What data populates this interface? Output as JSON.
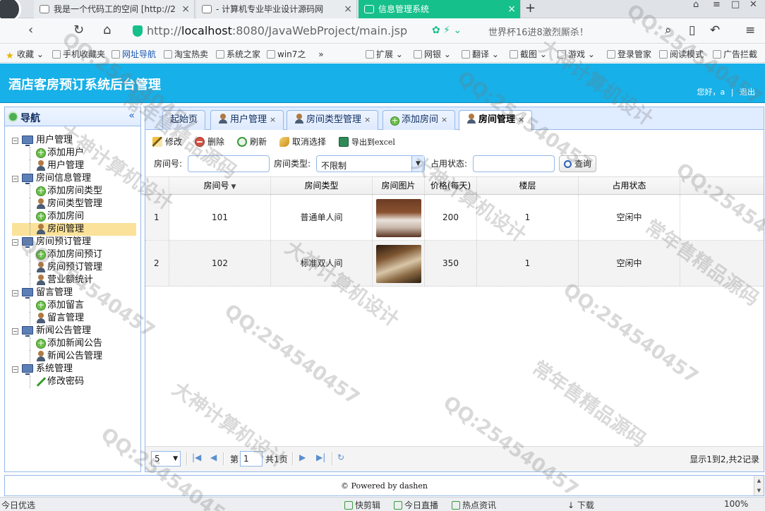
{
  "browser": {
    "tabs": [
      {
        "label": "我是一个代码工的空间 [http://2"
      },
      {
        "label": "- 计算机专业毕业设计源码网"
      },
      {
        "label": "信息管理系统"
      }
    ],
    "url_prefix": "http://",
    "url_host": "localhost",
    "url_path": ":8080/JavaWebProject/main.jsp",
    "search_promo": "世界杯16进8激烈厮杀！",
    "accent_color": "#16c08a"
  },
  "bookmarks": {
    "left": [
      "收藏",
      "手机收藏夹",
      "网址导航",
      "淘宝热卖",
      "系统之家",
      "win7之"
    ],
    "right": [
      "扩展",
      "网银",
      "翻译",
      "截图",
      "游戏",
      "登录管家",
      "阅读模式",
      "广告拦截"
    ]
  },
  "app": {
    "title": "酒店客房预订系统后台管理",
    "greeting": "您好，a",
    "logout": "退出",
    "header_color": "#17b0e8"
  },
  "nav": {
    "title": "导航",
    "collapse_icon": "«",
    "groups": [
      {
        "label": "用户管理",
        "items": [
          {
            "label": "添加用户",
            "icon": "add-icon"
          },
          {
            "label": "用户管理",
            "icon": "user-icon"
          }
        ]
      },
      {
        "label": "房间信息管理",
        "items": [
          {
            "label": "添加房间类型",
            "icon": "add-icon"
          },
          {
            "label": "房间类型管理",
            "icon": "user-icon"
          },
          {
            "label": "添加房间",
            "icon": "add-icon"
          },
          {
            "label": "房间管理",
            "icon": "user-icon",
            "selected": true
          }
        ]
      },
      {
        "label": "房间预订管理",
        "items": [
          {
            "label": "添加房间预订",
            "icon": "add-icon"
          },
          {
            "label": "房间预订管理",
            "icon": "user-icon"
          },
          {
            "label": "营业额统计",
            "icon": "user-icon"
          }
        ]
      },
      {
        "label": "留言管理",
        "items": [
          {
            "label": "添加留言",
            "icon": "add-icon"
          },
          {
            "label": "留言管理",
            "icon": "user-icon"
          }
        ]
      },
      {
        "label": "新闻公告管理",
        "items": [
          {
            "label": "添加新闻公告",
            "icon": "add-icon"
          },
          {
            "label": "新闻公告管理",
            "icon": "user-icon"
          }
        ]
      },
      {
        "label": "系统管理",
        "items": [
          {
            "label": "修改密码",
            "icon": "pencil-icon"
          }
        ]
      }
    ]
  },
  "panel_tabs": [
    {
      "label": "起始页"
    },
    {
      "label": "用户管理"
    },
    {
      "label": "房间类型管理"
    },
    {
      "label": "添加房间"
    },
    {
      "label": "房间管理"
    }
  ],
  "toolbar": {
    "edit": "修改",
    "delete": "删除",
    "refresh": "刷新",
    "unselect": "取消选择",
    "export": "导出到excel"
  },
  "search": {
    "room_no_label": "房间号:",
    "room_no_value": "",
    "room_type_label": "房间类型:",
    "room_type_value": "不限制",
    "status_label": "占用状态:",
    "status_value": "",
    "query": "查询"
  },
  "grid": {
    "columns": [
      "房间号",
      "房间类型",
      "房间图片",
      "价格(每天)",
      "楼层",
      "占用状态"
    ],
    "rows": [
      {
        "num": "1",
        "room_no": "101",
        "type": "普通单人间",
        "price": "200",
        "floor": "1",
        "status": "空闲中"
      },
      {
        "num": "2",
        "room_no": "102",
        "type": "标准双人间",
        "price": "350",
        "floor": "1",
        "status": "空闲中"
      }
    ]
  },
  "pager": {
    "page_size": "5",
    "page_prefix": "第",
    "page_value": "1",
    "page_total": "共1页",
    "summary": "显示1到2,共2记录"
  },
  "footer": {
    "text": "© Powered by dashen"
  },
  "statusbar": {
    "left": "今日优选",
    "items": [
      "快剪辑",
      "今日直播",
      "热点资讯"
    ],
    "download": "下载",
    "zoom": "100%"
  },
  "watermarks": [
    "QQ:254540457",
    "常年售精品源码",
    "大神计算机设计"
  ]
}
